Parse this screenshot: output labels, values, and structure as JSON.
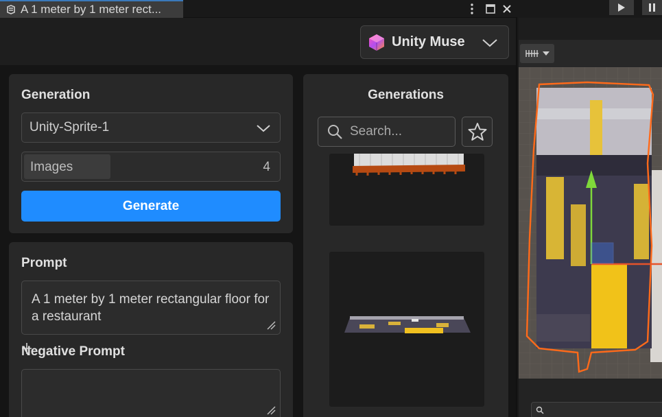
{
  "window": {
    "tab_title": "A 1 meter by 1 meter rect...",
    "menu_icon": "kebab-menu-icon",
    "maximize_icon": "maximize-icon",
    "close_icon": "close-icon"
  },
  "header": {
    "product_dropdown": "Unity Muse"
  },
  "generation": {
    "title": "Generation",
    "model": "Unity-Sprite-1",
    "images_label": "Images",
    "images_count": "4",
    "images_fraction": 0.34,
    "generate_label": "Generate"
  },
  "prompt": {
    "title": "Prompt",
    "value": "A 1 meter by 1 meter rectangular floor for a restaurant",
    "negative_title": "Negative Prompt",
    "negative_value": ""
  },
  "generations": {
    "title": "Generations",
    "search_placeholder": "Search...",
    "favorite_icon": "star-icon"
  },
  "colors": {
    "accent": "#1f8cff",
    "panel": "#1e1e1e",
    "card": "#282828",
    "selection_outline": "#ff6a1a",
    "gizmo_green": "#7fd83a"
  }
}
